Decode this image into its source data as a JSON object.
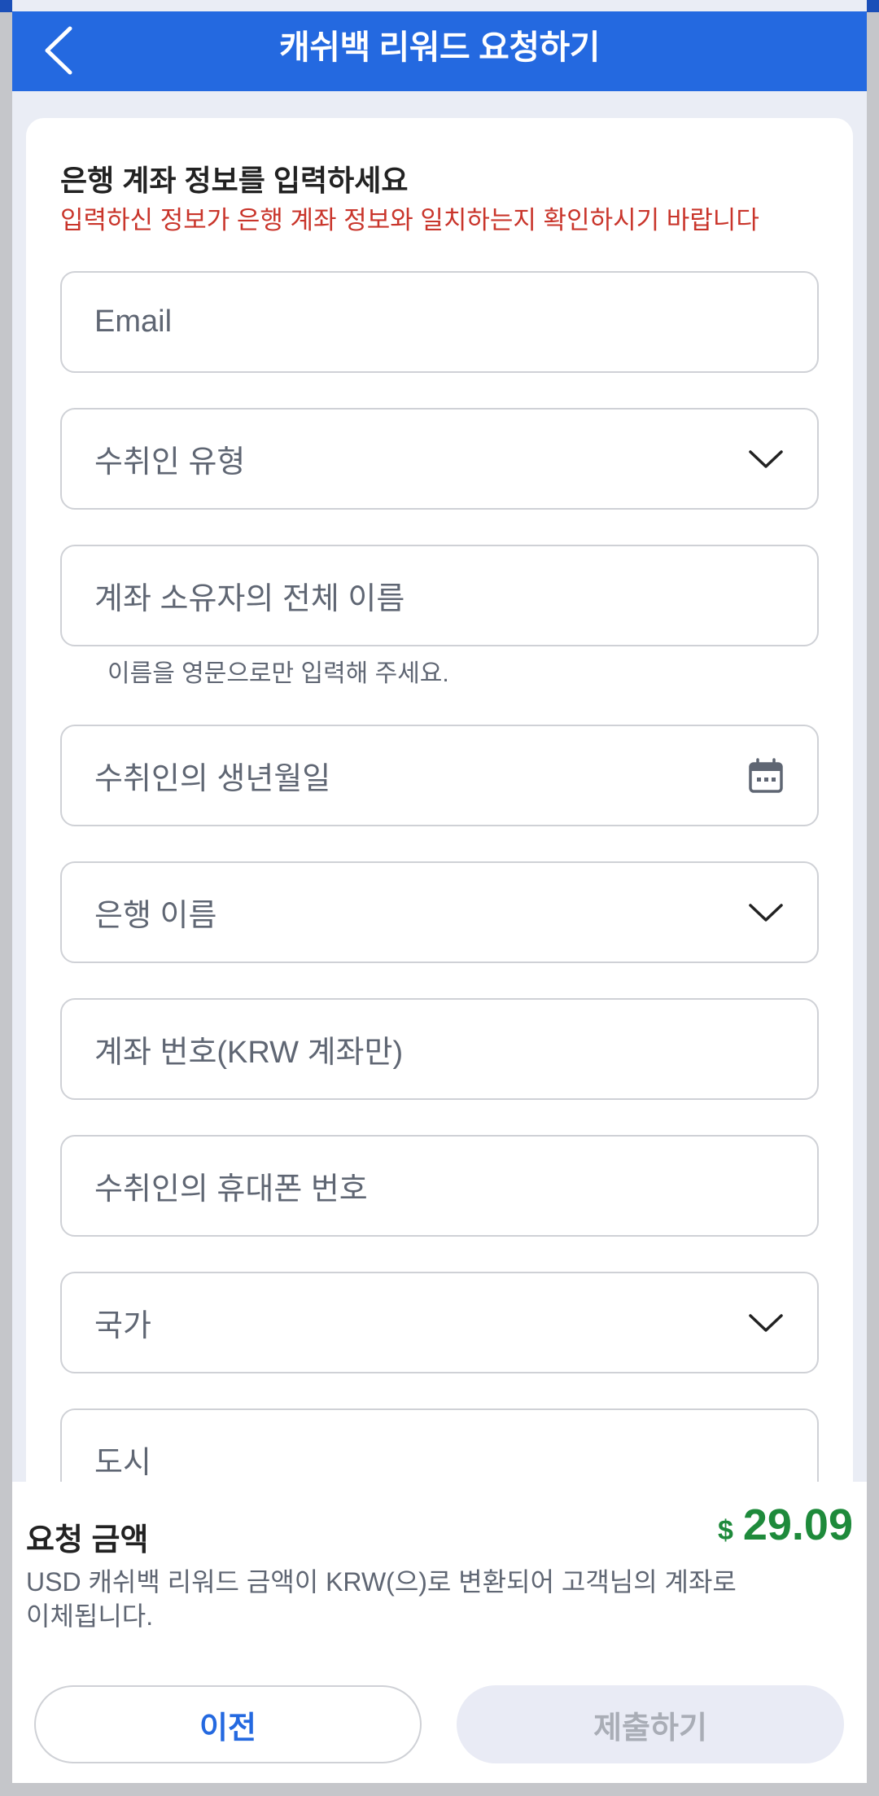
{
  "header": {
    "title": "캐쉬백 리워드 요청하기"
  },
  "form": {
    "heading": "은행 계좌 정보를 입력하세요",
    "warning": "입력하신 정보가 은행 계좌 정보와 일치하는지 확인하시기 바랍니다",
    "fields": {
      "email": "Email",
      "recipient_type": "수취인 유형",
      "full_name": "계좌 소유자의 전체 이름",
      "full_name_helper": "이름을 영문으로만 입력해 주세요.",
      "birth_date": "수취인의 생년월일",
      "bank_name": "은행 이름",
      "account_number": "계좌 번호(KRW 계좌만)",
      "phone": "수취인의 휴대폰 번호",
      "country": "국가",
      "city": "도시"
    }
  },
  "summary": {
    "label": "요청 금액",
    "currency_symbol": "$",
    "amount": "29.09",
    "note": "USD 캐쉬백 리워드 금액이 KRW(으)로 변환되어 고객님의 계좌로 이체됩니다."
  },
  "buttons": {
    "prev": "이전",
    "submit": "제출하기"
  },
  "colors": {
    "primary": "#2469e0",
    "warning": "#c9352b",
    "amount": "#1e8a3b"
  }
}
